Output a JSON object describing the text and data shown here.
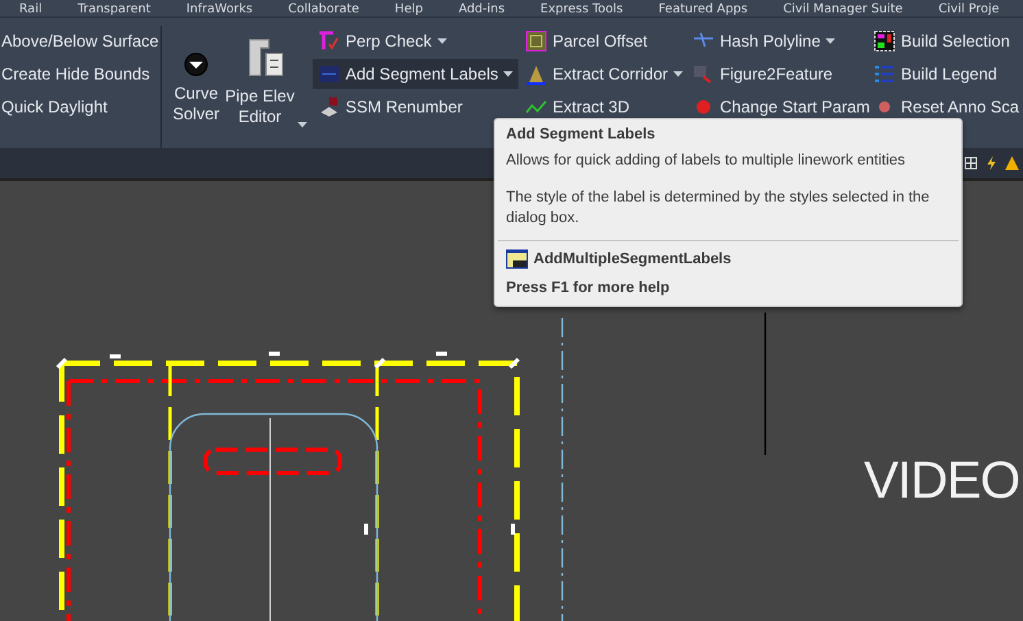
{
  "menu_bar": [
    "Rail",
    "Transparent",
    "InfraWorks",
    "Collaborate",
    "Help",
    "Add-ins",
    "Express Tools",
    "Featured Apps",
    "Civil Manager Suite",
    "Civil Proje"
  ],
  "ribbon": {
    "left_column": [
      "Above/Below Surface",
      "Create Hide Bounds",
      "Quick Daylight"
    ],
    "large_buttons": [
      {
        "label": "Curve Solver",
        "dropdown": false
      },
      {
        "label": "Pipe Elev Editor",
        "dropdown": true
      }
    ],
    "columns": [
      [
        {
          "label": "Perp Check",
          "dropdown": true,
          "highlighted": false
        },
        {
          "label": "Add Segment Labels",
          "dropdown": true,
          "highlighted": true
        },
        {
          "label": "SSM Renumber",
          "dropdown": false,
          "highlighted": false
        }
      ],
      [
        {
          "label": "Parcel Offset",
          "dropdown": false,
          "highlighted": false
        },
        {
          "label": "Extract Corridor",
          "dropdown": true,
          "highlighted": false
        },
        {
          "label": "Extract 3D",
          "dropdown": false,
          "highlighted": false
        }
      ],
      [
        {
          "label": "Hash Polyline",
          "dropdown": true,
          "highlighted": false
        },
        {
          "label": "Figure2Feature",
          "dropdown": false,
          "highlighted": false
        },
        {
          "label": "Change Start Param",
          "dropdown": false,
          "highlighted": false
        }
      ],
      [
        {
          "label": "Build Selection",
          "dropdown": false,
          "highlighted": false
        },
        {
          "label": "Build Legend",
          "dropdown": false,
          "highlighted": false
        },
        {
          "label": "Reset Anno Sca",
          "dropdown": false,
          "highlighted": false
        }
      ]
    ]
  },
  "tooltip": {
    "title": "Add Segment Labels",
    "description": "Allows for quick adding of labels to multiple linework entities",
    "details": "The style of the label is determined by the styles selected in the dialog box.",
    "command": "AddMultipleSegmentLabels",
    "help": "Press F1 for more help"
  },
  "canvas": {
    "text": "VIDEO"
  }
}
